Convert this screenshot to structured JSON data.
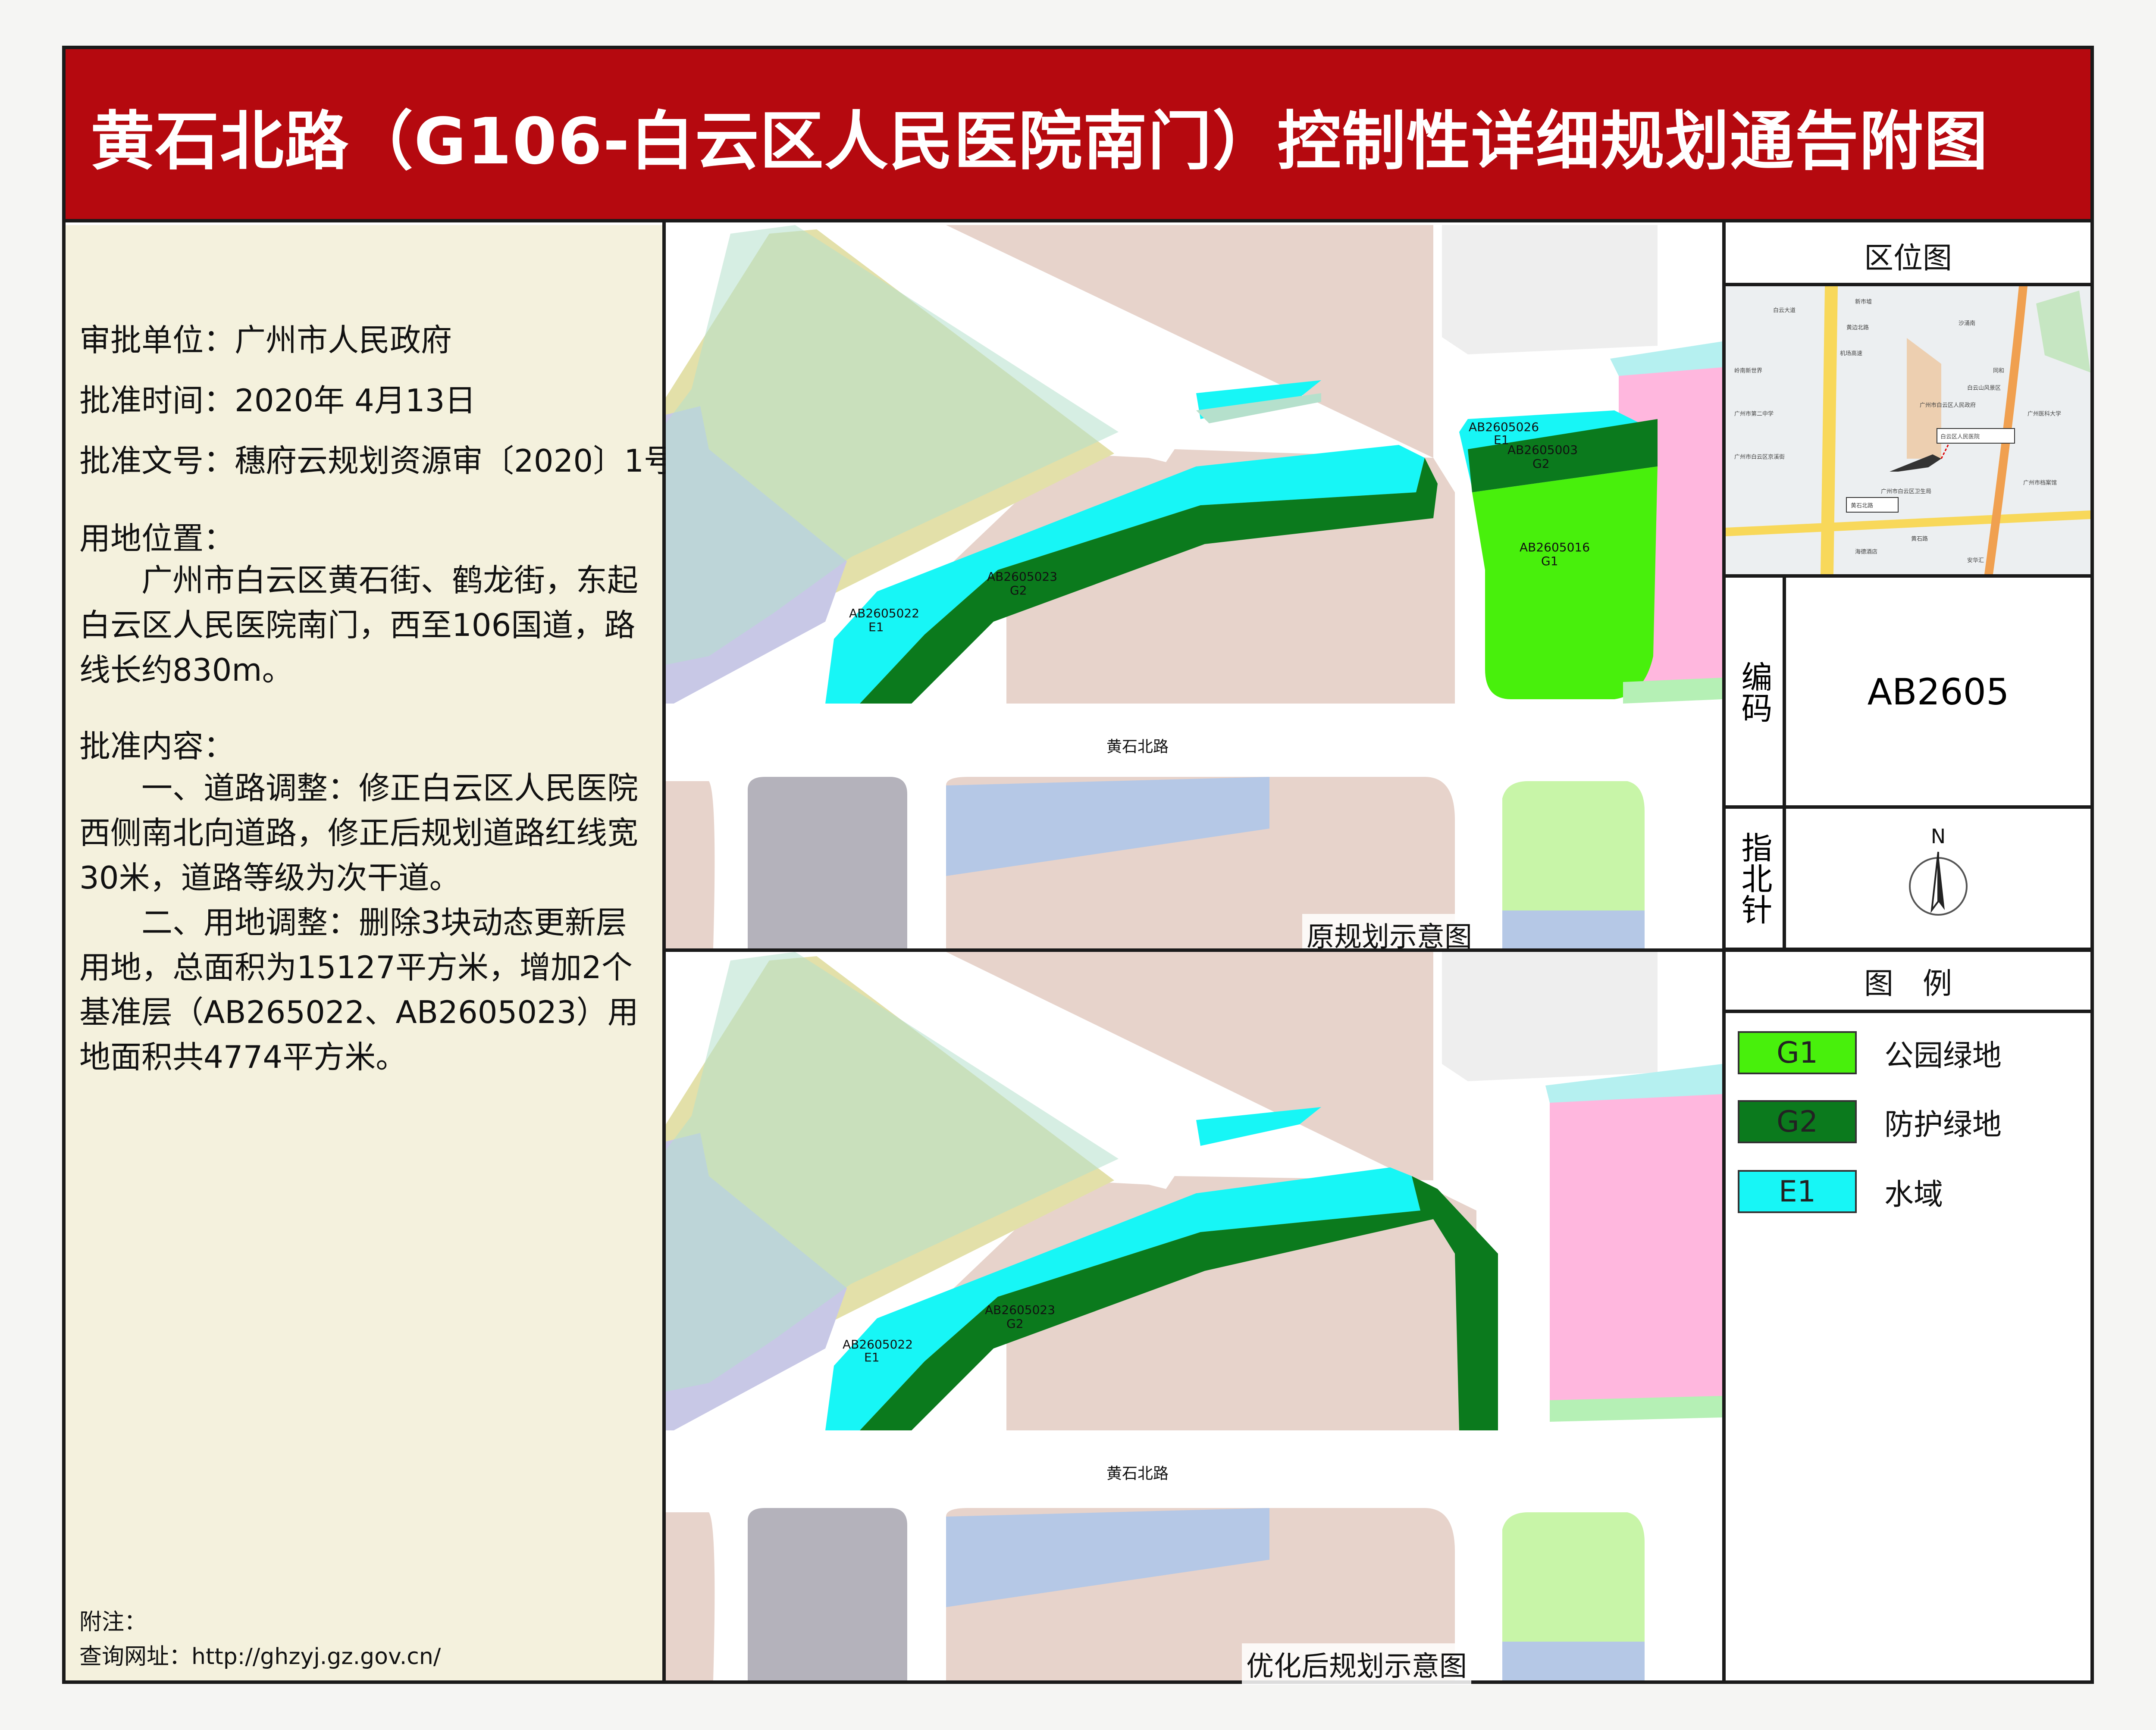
{
  "title": "黄石北路（G106-白云区人民医院南门）控制性详细规划通告附图",
  "info": {
    "approval_unit": "审批单位：广州市人民政府",
    "approval_time": "批准时间：2020年 4月13日",
    "approval_doc": "批准文号：穗府云规划资源审〔2020〕1号",
    "location_heading": "用地位置：",
    "location_text": "广州市白云区黄石街、鹤龙街，东起白云区人民医院南门，西至106国道，路线长约830m。",
    "content_heading": "批准内容：",
    "content_p1": "一、道路调整：修正白云区人民医院西侧南北向道路，修正后规划道路红线宽30米，道路等级为次干道。",
    "content_p2": "二、用地调整：删除3块动态更新层用地，总面积为15127平方米，增加2个基准层（AB265022、AB2605023）用地面积共4774平方米。",
    "note_label": "附注：",
    "query_url": "查询网址：http://ghzyj.gz.gov.cn/"
  },
  "maps": {
    "original_caption": "原规划示意图",
    "optimized_caption": "优化后规划示意图",
    "road_name": "黄石北路",
    "original_parcels": [
      {
        "code": "AB2605022",
        "type": "E1"
      },
      {
        "code": "AB2605023",
        "type": "G2"
      },
      {
        "code": "AB2605026",
        "type": "E1"
      },
      {
        "code": "AB2605003",
        "type": "G2"
      },
      {
        "code": "AB2605016",
        "type": "G1"
      }
    ],
    "optimized_parcels": [
      {
        "code": "AB2605022",
        "type": "E1"
      },
      {
        "code": "AB2605023",
        "type": "G2"
      }
    ]
  },
  "location_map": {
    "heading": "区位图",
    "labels": [
      "机场高速",
      "白云区人民医院",
      "黄石北路",
      "黄石路",
      "广州市白云区人民政府",
      "岭南新世界",
      "广州市第二中学",
      "广州市白云区京溪街",
      "海德酒店",
      "安华汇",
      "广州市档案馆",
      "白云大道",
      "新市墟",
      "沙涌南",
      "同和",
      "广州医科大学",
      "白云山风景区",
      "广州市白云区卫生局",
      "黄边北路",
      "白云机场高速"
    ]
  },
  "code_panel": {
    "label": "编码",
    "code": "AB2605"
  },
  "north_panel": {
    "label": "指北针",
    "north_letter": "N"
  },
  "legend": {
    "heading": "图　例",
    "items": [
      {
        "code": "G1",
        "label": "公园绿地",
        "color": "#48f00c"
      },
      {
        "code": "G2",
        "label": "防护绿地",
        "color": "#0b7a1d"
      },
      {
        "code": "E1",
        "label": "水域",
        "color": "#17f6f6"
      }
    ]
  },
  "colors": {
    "title_bg": "#b5090f",
    "info_bg": "#f4f1dd",
    "residential": "#e7d3cb",
    "park": "#48f00c",
    "protective_green": "#0b7a1d",
    "water": "#17f6f6",
    "medical": "#ffb7de",
    "education": "#c8c8e6",
    "commercial": "#e3e0a9",
    "gray_block": "#b4b2bb",
    "blue_block": "#b5c8e6",
    "green_edge": "#b5e0cc"
  }
}
